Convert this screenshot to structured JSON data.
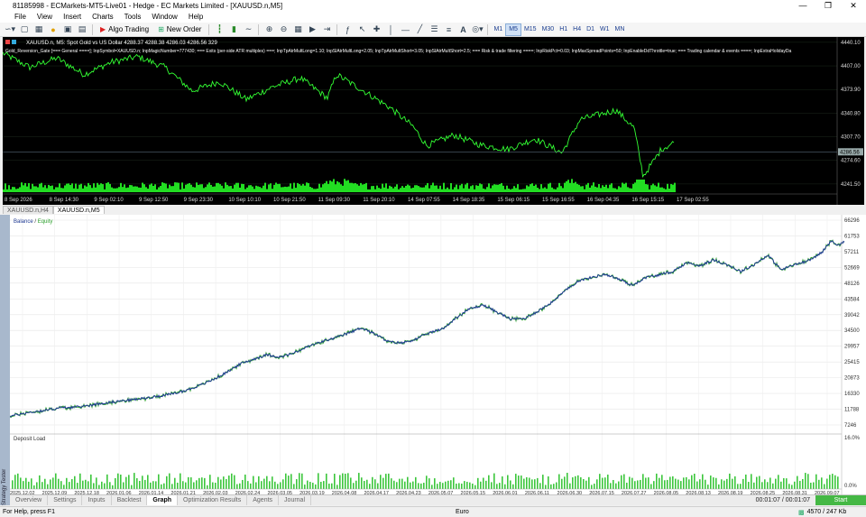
{
  "window": {
    "title": "81185998 - ECMarkets-MT5-Live01 - Hedge - EC Markets Limited - [XAUUSD.n,M5]"
  },
  "menu": [
    "File",
    "View",
    "Insert",
    "Charts",
    "Tools",
    "Window",
    "Help"
  ],
  "toolbar": {
    "algo_trading": "Algo Trading",
    "new_order": "New Order",
    "timeframes": [
      "M1",
      "M5",
      "M15",
      "M30",
      "H1",
      "H4",
      "D1",
      "W1",
      "MN"
    ],
    "active_timeframe": "M5"
  },
  "chart": {
    "header": "XAUUSD.n, M5:  Spot Gold vs US Dollar  4288.37 4288.38 4286.03 4286.56  329",
    "ea_inputs": "Gold_Reversion_Gate [=== General ====]; InpSymbol=XAUUSD.n; InpMagicNumber=777430; === Exits (per-side ATR multiples) ===; InpTpAtrMultLong=1.10; InpSlAtrMultLong=2.05; InpTpAtrMultShort=3.05; InpSlAtrMultShort=2.5; === Risk & trade filtering ====; InpRiskPct=0.03; InpMaxSpreadPoints=50; InpEnableDdThrottle=true; === Trading calendar & events ====; InpExtraHolidayDa",
    "price_labels": [
      "4440.10",
      "4407.00",
      "4373.90",
      "4340.80",
      "4307.70",
      "4274.60",
      "4241.50"
    ],
    "current_price": "4286.56",
    "time_labels": [
      "8 Sep 2026",
      "8 Sep 14:30",
      "9 Sep 02:10",
      "9 Sep 12:50",
      "9 Sep 23:30",
      "10 Sep 10:10",
      "10 Sep 21:50",
      "11 Sep 09:30",
      "11 Sep 20:10",
      "14 Sep 07:55",
      "14 Sep 18:35",
      "15 Sep 06:15",
      "15 Sep 16:55",
      "16 Sep 04:35",
      "16 Sep 15:15",
      "17 Sep 02:55"
    ],
    "tabs": [
      "XAUUSD.n,H4",
      "XAUUSD.n,M5"
    ],
    "active_tab": "XAUUSD.n,M5"
  },
  "tester": {
    "side_label": "Strategy Tester",
    "legend_balance": "Balance",
    "legend_sep": " / ",
    "legend_equity": "Equity",
    "deposit_load_label": "Deposit Load",
    "y_labels": [
      "66296",
      "61753",
      "57211",
      "52669",
      "48126",
      "43584",
      "39042",
      "34500",
      "29957",
      "25415",
      "20873",
      "16330",
      "11788",
      "7246"
    ],
    "load_labels": [
      "16.0%",
      "0.0%"
    ],
    "x_labels": [
      "2025.12.02",
      "2025.12.09",
      "2025.12.18",
      "2026.01.06",
      "2026.01.14",
      "2026.01.21",
      "2026.02.03",
      "2026.02.24",
      "2026.03.05",
      "2026.03.19",
      "2026.04.08",
      "2026.04.17",
      "2026.04.23",
      "2026.05.07",
      "2026.05.15",
      "2026.06.01",
      "2026.06.11",
      "2026.06.30",
      "2026.07.15",
      "2026.07.27",
      "2026.08.05",
      "2026.08.13",
      "2026.08.19",
      "2026.08.25",
      "2026.08.31",
      "2026.09.07"
    ],
    "tabs": [
      "Overview",
      "Settings",
      "Inputs",
      "Backtest",
      "Graph",
      "Optimization Results",
      "Agents",
      "Journal"
    ],
    "active_tab": "Graph",
    "timer": "00:01:07 / 00:01:07",
    "start_button": "Start"
  },
  "status": {
    "help": "For Help, press F1",
    "profile": "Euro",
    "traffic": "4570 / 247 Kb"
  },
  "colors": {
    "balance": "#1f3a93",
    "equity": "#2ca02c",
    "price_line": "#33ff33",
    "volume": "#22dd22",
    "start_button": "#45b845",
    "tester_side": "#a8b8cc"
  },
  "chart_data": [
    {
      "type": "line",
      "title": "Balance / Equity",
      "series": [
        {
          "name": "Balance",
          "x_index": [
            0,
            10,
            20,
            40,
            55,
            75,
            90,
            105,
            120,
            135,
            150,
            165,
            180,
            195,
            210,
            225,
            240,
            255,
            270,
            285,
            300,
            315,
            330,
            345,
            360,
            375,
            390,
            405,
            420,
            435,
            450,
            465,
            480,
            495,
            510,
            525,
            540,
            555,
            570,
            585,
            600,
            615,
            630,
            645,
            660,
            675,
            690,
            705,
            720,
            735,
            750,
            765,
            780,
            795,
            810,
            825,
            840,
            855,
            870,
            885,
            900,
            911,
            918,
            925
          ],
          "values": [
            9800,
            10300,
            10800,
            11500,
            12200,
            12400,
            13000,
            13600,
            14100,
            14500,
            15000,
            15600,
            16200,
            17200,
            18600,
            20300,
            22400,
            24800,
            26200,
            27500,
            26800,
            28000,
            29800,
            31200,
            32300,
            33700,
            35300,
            33400,
            31200,
            30900,
            32000,
            33800,
            35000,
            38200,
            40800,
            41800,
            39800,
            37800,
            37900,
            40000,
            42500,
            45800,
            48800,
            49800,
            50700,
            49300,
            47500,
            49800,
            50500,
            51500,
            54000,
            53200,
            54800,
            53500,
            51500,
            53500,
            56200,
            52000,
            53500,
            54500,
            57000,
            60500,
            59000,
            60200
          ]
        },
        {
          "name": "Equity",
          "note": "closely tracks balance with small deviations"
        }
      ],
      "ylim": [
        7246,
        66296
      ],
      "grid": true
    },
    {
      "type": "line",
      "title": "XAUUSD.n, M5",
      "series": [
        {
          "name": "Price",
          "x_index": [
            0,
            30,
            60,
            90,
            120,
            150,
            180,
            210,
            240,
            270,
            300,
            330,
            360,
            370,
            400,
            430,
            455,
            470,
            500,
            530,
            560,
            590,
            620,
            640,
            680,
            700,
            710,
            730,
            745
          ],
          "values": [
            4425,
            4405,
            4418,
            4395,
            4412,
            4420,
            4405,
            4372,
            4385,
            4360,
            4378,
            4390,
            4362,
            4395,
            4372,
            4348,
            4322,
            4295,
            4310,
            4296,
            4290,
            4305,
            4285,
            4332,
            4345,
            4320,
            4252,
            4290,
            4300
          ]
        }
      ],
      "ylim": [
        4230,
        4445
      ]
    }
  ]
}
